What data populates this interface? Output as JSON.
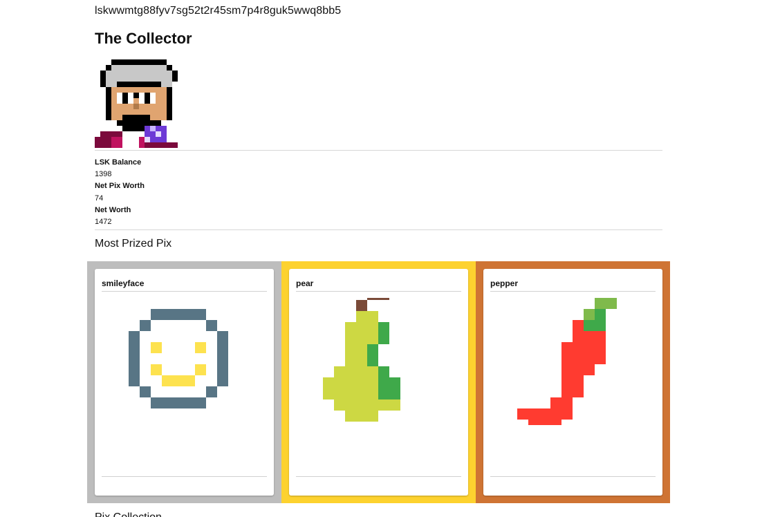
{
  "profile": {
    "address": "lskwwmtg88fyv7sg52t2r45sm7p4r8guk5wwq8bb5",
    "title": "The Collector"
  },
  "stats": [
    {
      "label": "LSK Balance",
      "value": "1398"
    },
    {
      "label": "Net Pix Worth",
      "value": "74"
    },
    {
      "label": "Net Worth",
      "value": "1472"
    }
  ],
  "prized": {
    "heading": "Most Prized Pix",
    "cards": [
      {
        "name": "smileyface",
        "tier_color": "#bdbdbd"
      },
      {
        "name": "pear",
        "tier_color": "#fdd22f"
      },
      {
        "name": "pepper",
        "tier_color": "#cf7434"
      }
    ]
  },
  "next_section": {
    "heading": "Pix Collection"
  }
}
